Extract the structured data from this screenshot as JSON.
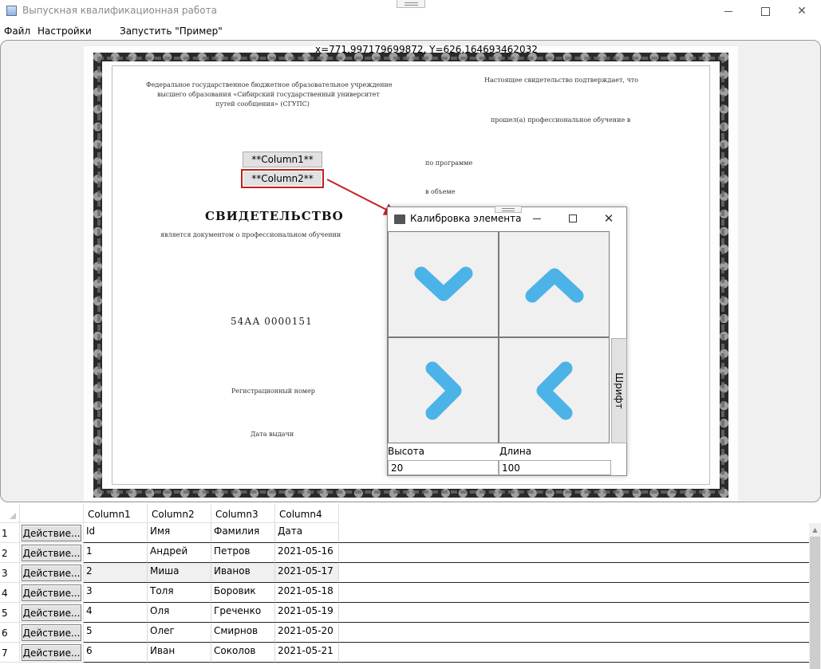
{
  "window": {
    "title": "Выпускная квалификационная работа"
  },
  "menu": [
    "Файл",
    "Настройки",
    "Запустить \"Пример\""
  ],
  "coordinates_readout": "x=771,997179699872, Y=626,164693462032",
  "document": {
    "header_left": [
      "Федеральное государственное бюджетное образовательное учреждение",
      "высшего образования «Сибирский государственный университет",
      "путей сообщения» (СГУПС)"
    ],
    "header_right": "Настоящее свидетельство подтверждает, что",
    "right_line_1": "прошел(а) профессиональное обучение в",
    "right_line_2": "по программе",
    "right_line_3": "в объеме",
    "title": "СВИДЕТЕЛЬСТВО",
    "subtitle": "является документом о профессиональном обучении",
    "serial": "54АА  0000151",
    "reg_number": "Регистрационный номер",
    "issue_date": "Дата выдачи",
    "fields": [
      "**Column1**",
      "**Column2**"
    ]
  },
  "calibration": {
    "title": "Калибровка элемента",
    "font_button": "Шрифт",
    "height_label": "Высота",
    "length_label": "Длина",
    "height_value": "20",
    "length_value": "100",
    "arrow_color": "#4bb3e8",
    "arrows": [
      "chevron-down-icon",
      "chevron-up-icon",
      "chevron-right-icon",
      "chevron-left-icon"
    ]
  },
  "grid": {
    "columns": [
      "Column1",
      "Column2",
      "Column3",
      "Column4"
    ],
    "action_label": "Действие...",
    "rows": [
      {
        "num": "1",
        "cells": [
          "Id",
          "Имя",
          "Фамилия",
          "Дата"
        ]
      },
      {
        "num": "2",
        "cells": [
          "1",
          "Андрей",
          "Петров",
          "2021-05-16"
        ]
      },
      {
        "num": "3",
        "cells": [
          "2",
          "Миша",
          "Иванов",
          "2021-05-17"
        ]
      },
      {
        "num": "4",
        "cells": [
          "3",
          "Толя",
          "Боровик",
          "2021-05-18"
        ]
      },
      {
        "num": "5",
        "cells": [
          "4",
          "Оля",
          "Греченко",
          "2021-05-19"
        ]
      },
      {
        "num": "6",
        "cells": [
          "5",
          "Олег",
          "Смирнов",
          "2021-05-20"
        ]
      },
      {
        "num": "7",
        "cells": [
          "6",
          "Иван",
          "Соколов",
          "2021-05-21"
        ]
      }
    ]
  }
}
